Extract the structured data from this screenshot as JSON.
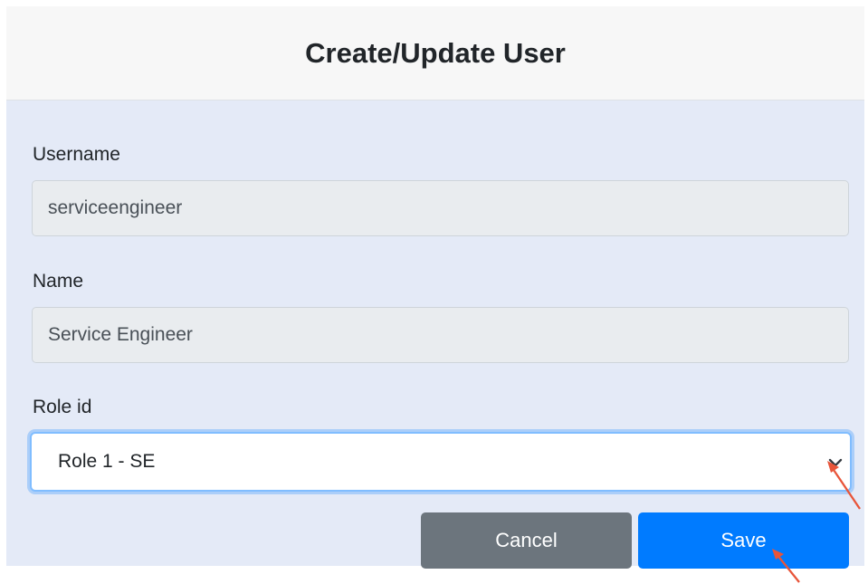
{
  "dialog": {
    "title": "Create/Update User"
  },
  "form": {
    "username": {
      "label": "Username",
      "value": "serviceengineer"
    },
    "name": {
      "label": "Name",
      "value": "Service Engineer"
    },
    "role": {
      "label": "Role id",
      "selected": "Role 1 - SE"
    }
  },
  "buttons": {
    "cancel_label": "Cancel",
    "save_label": "Save"
  },
  "colors": {
    "save": "#007bff",
    "cancel": "#6c757d",
    "annotation_arrow": "#e8553a",
    "body_background": "#e4eaf7"
  },
  "icons": {
    "select_indicator": "chevron-down-icon",
    "annotation": "arrow-icon"
  }
}
